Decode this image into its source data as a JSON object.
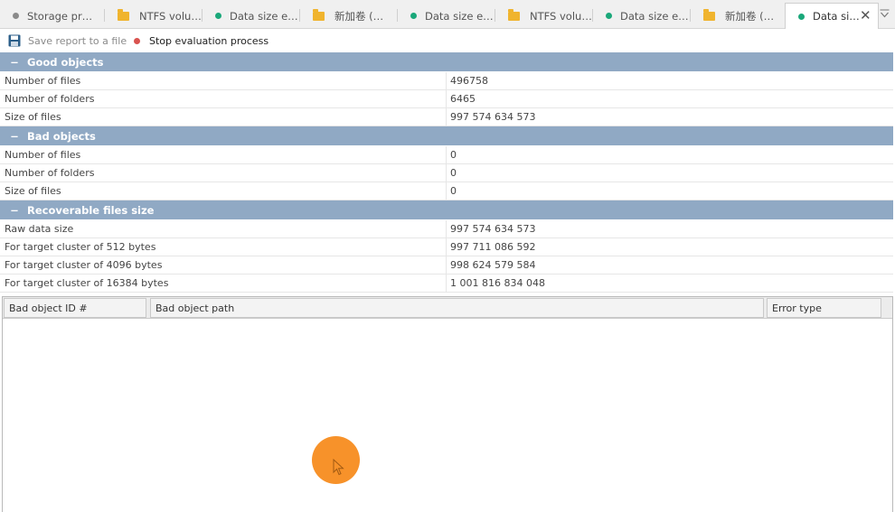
{
  "tabs": [
    {
      "label": "Storage pr…",
      "icon": "gray-dot-icon"
    },
    {
      "label": "NTFS volu…",
      "icon": "folder-icon"
    },
    {
      "label": "Data size e…",
      "icon": "green-dot-icon"
    },
    {
      "label": "新加卷 (…",
      "icon": "folder-icon"
    },
    {
      "label": "Data size e…",
      "icon": "green-dot-icon"
    },
    {
      "label": "NTFS volu…",
      "icon": "folder-icon"
    },
    {
      "label": "Data size e…",
      "icon": "green-dot-icon"
    },
    {
      "label": "新加卷 (…",
      "icon": "folder-icon"
    },
    {
      "label": "Data si…",
      "icon": "green-dot-icon",
      "active": true
    }
  ],
  "toolbar": {
    "save_label": "Save report to a file",
    "stop_label": "Stop evaluation process"
  },
  "sections": [
    {
      "title": "Good objects",
      "rows": [
        {
          "label": "Number of files",
          "value": "496758"
        },
        {
          "label": "Number of folders",
          "value": "6465"
        },
        {
          "label": "Size of files",
          "value": "997 574 634 573"
        }
      ]
    },
    {
      "title": "Bad objects",
      "rows": [
        {
          "label": "Number of files",
          "value": "0"
        },
        {
          "label": "Number of folders",
          "value": "0"
        },
        {
          "label": "Size of files",
          "value": "0"
        }
      ]
    },
    {
      "title": "Recoverable files size",
      "rows": [
        {
          "label": "Raw data size",
          "value": "997 574 634 573"
        },
        {
          "label": "For target cluster of 512 bytes",
          "value": "997 711 086 592"
        },
        {
          "label": "For target cluster of 4096 bytes",
          "value": "998 624 579 584"
        },
        {
          "label": "For target cluster of 16384 bytes",
          "value": "1 001 816 834 048"
        }
      ]
    }
  ],
  "bad_objects_table": {
    "columns": [
      "Bad object ID #",
      "Bad object path",
      "Error type"
    ],
    "rows": []
  },
  "colors": {
    "section_header": "#90a9c4",
    "accent_green": "#1aa87a",
    "folder": "#f0b42e",
    "stop": "#d9534f",
    "cursor_highlight": "#f7922a"
  }
}
